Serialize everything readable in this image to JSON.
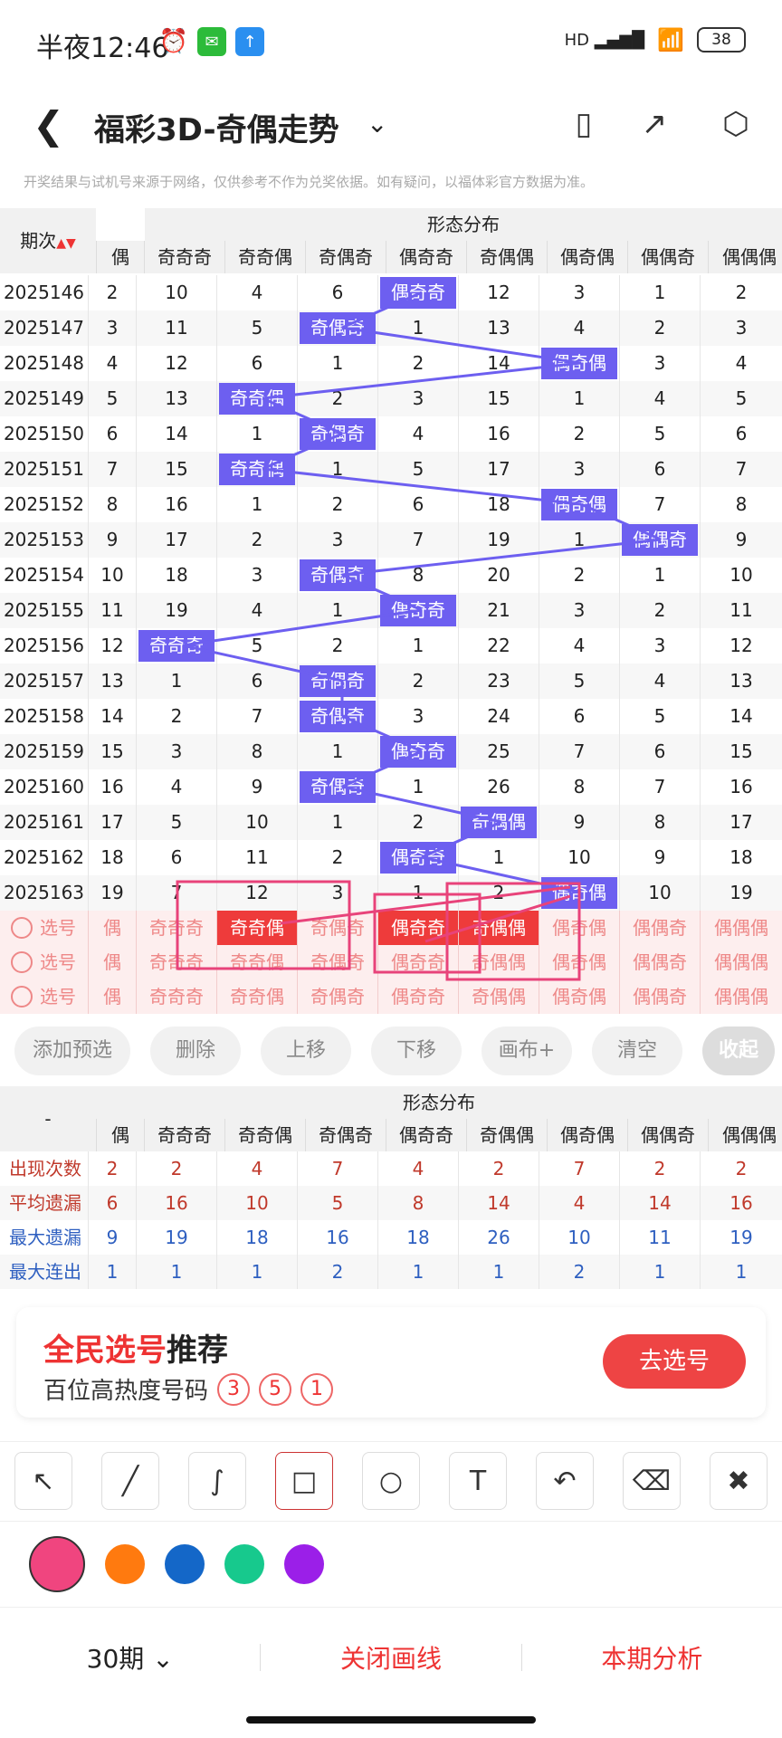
{
  "status": {
    "time": "半夜12:46",
    "battery": "38",
    "signal_label": "HD"
  },
  "header": {
    "title": "福彩3D-奇偶走势"
  },
  "disclaimer": "开奖结果与试机号来源于网络，仅供参考不作为兑奖依据。如有疑问，以福体彩官方数据为准。",
  "table": {
    "period_header": "期次",
    "group_header": "形态分布",
    "columns": [
      "偶",
      "奇奇奇",
      "奇奇偶",
      "奇偶奇",
      "偶奇奇",
      "奇偶偶",
      "偶奇偶",
      "偶偶奇",
      "偶偶偶"
    ],
    "rows": [
      {
        "period": "2025146",
        "cells": [
          "2",
          "10",
          "4",
          "6",
          "偶奇奇",
          "12",
          "3",
          "1",
          "2"
        ]
      },
      {
        "period": "2025147",
        "cells": [
          "3",
          "11",
          "5",
          "奇偶奇",
          "1",
          "13",
          "4",
          "2",
          "3"
        ]
      },
      {
        "period": "2025148",
        "cells": [
          "4",
          "12",
          "6",
          "1",
          "2",
          "14",
          "偶奇偶",
          "3",
          "4"
        ]
      },
      {
        "period": "2025149",
        "cells": [
          "5",
          "13",
          "奇奇偶",
          "2",
          "3",
          "15",
          "1",
          "4",
          "5"
        ]
      },
      {
        "period": "2025150",
        "cells": [
          "6",
          "14",
          "1",
          "奇偶奇",
          "4",
          "16",
          "2",
          "5",
          "6"
        ]
      },
      {
        "period": "2025151",
        "cells": [
          "7",
          "15",
          "奇奇偶",
          "1",
          "5",
          "17",
          "3",
          "6",
          "7"
        ]
      },
      {
        "period": "2025152",
        "cells": [
          "8",
          "16",
          "1",
          "2",
          "6",
          "18",
          "偶奇偶",
          "7",
          "8"
        ]
      },
      {
        "period": "2025153",
        "cells": [
          "9",
          "17",
          "2",
          "3",
          "7",
          "19",
          "1",
          "偶偶奇",
          "9"
        ]
      },
      {
        "period": "2025154",
        "cells": [
          "10",
          "18",
          "3",
          "奇偶奇",
          "8",
          "20",
          "2",
          "1",
          "10"
        ]
      },
      {
        "period": "2025155",
        "cells": [
          "11",
          "19",
          "4",
          "1",
          "偶奇奇",
          "21",
          "3",
          "2",
          "11"
        ]
      },
      {
        "period": "2025156",
        "cells": [
          "12",
          "奇奇奇",
          "5",
          "2",
          "1",
          "22",
          "4",
          "3",
          "12"
        ]
      },
      {
        "period": "2025157",
        "cells": [
          "13",
          "1",
          "6",
          "奇偶奇",
          "2",
          "23",
          "5",
          "4",
          "13"
        ]
      },
      {
        "period": "2025158",
        "cells": [
          "14",
          "2",
          "7",
          "奇偶奇",
          "3",
          "24",
          "6",
          "5",
          "14"
        ]
      },
      {
        "period": "2025159",
        "cells": [
          "15",
          "3",
          "8",
          "1",
          "偶奇奇",
          "25",
          "7",
          "6",
          "15"
        ]
      },
      {
        "period": "2025160",
        "cells": [
          "16",
          "4",
          "9",
          "奇偶奇",
          "1",
          "26",
          "8",
          "7",
          "16"
        ]
      },
      {
        "period": "2025161",
        "cells": [
          "17",
          "5",
          "10",
          "1",
          "2",
          "奇偶偶",
          "9",
          "8",
          "17"
        ]
      },
      {
        "period": "2025162",
        "cells": [
          "18",
          "6",
          "11",
          "2",
          "偶奇奇",
          "1",
          "10",
          "9",
          "18"
        ]
      },
      {
        "period": "2025163",
        "cells": [
          "19",
          "7",
          "12",
          "3",
          "1",
          "2",
          "偶奇偶",
          "10",
          "19"
        ]
      }
    ]
  },
  "pick": {
    "label": "选号",
    "rows": [
      {
        "cells": [
          "偶",
          "奇奇奇",
          "奇奇偶",
          "奇偶奇",
          "偶奇奇",
          "奇偶偶",
          "偶奇偶",
          "偶偶奇",
          "偶偶偶"
        ],
        "selected": [
          2,
          4,
          5
        ]
      },
      {
        "cells": [
          "偶",
          "奇奇奇",
          "奇奇偶",
          "奇偶奇",
          "偶奇奇",
          "奇偶偶",
          "偶奇偶",
          "偶偶奇",
          "偶偶偶"
        ],
        "selected": []
      },
      {
        "cells": [
          "偶",
          "奇奇奇",
          "奇奇偶",
          "奇偶奇",
          "偶奇奇",
          "奇偶偶",
          "偶奇偶",
          "偶偶奇",
          "偶偶偶"
        ],
        "selected": []
      }
    ]
  },
  "buttons": {
    "add": "添加预选",
    "delete": "删除",
    "up": "上移",
    "down": "下移",
    "canvas": "画布+",
    "clear": "清空",
    "collapse": "收起"
  },
  "stats": {
    "dash": "-",
    "group_header": "形态分布",
    "rows": [
      {
        "label": "出现次数",
        "color": "#c0392b",
        "cells": [
          "2",
          "2",
          "4",
          "7",
          "4",
          "2",
          "7",
          "2",
          "2"
        ]
      },
      {
        "label": "平均遗漏",
        "color": "#c0392b",
        "cells": [
          "6",
          "16",
          "10",
          "5",
          "8",
          "14",
          "4",
          "14",
          "16"
        ]
      },
      {
        "label": "最大遗漏",
        "color": "#2e5fc0",
        "cells": [
          "9",
          "19",
          "18",
          "16",
          "18",
          "26",
          "10",
          "11",
          "19"
        ]
      },
      {
        "label": "最大连出",
        "color": "#2e5fc0",
        "cells": [
          "1",
          "1",
          "1",
          "2",
          "1",
          "1",
          "2",
          "1",
          "1"
        ]
      }
    ]
  },
  "promo": {
    "title_red": "全民选号",
    "title_rest": "推荐",
    "subtitle": "百位高热度号码",
    "balls": [
      "3",
      "5",
      "1"
    ],
    "button": "去选号"
  },
  "tools": [
    "arrow-tool",
    "line-tool",
    "freehand-tool",
    "rectangle-tool",
    "circle-tool",
    "text-tool",
    "undo-tool",
    "eraser-tool",
    "clear-tool"
  ],
  "colors": [
    "#f0457f",
    "#ff7a0f",
    "#1467c8",
    "#17c98d",
    "#9b1fe8"
  ],
  "bottom": {
    "periods": "30期",
    "close_line": "关闭画线",
    "analysis": "本期分析"
  },
  "hit_color": "#6d5ff0",
  "line_color": "#6d5ff0"
}
